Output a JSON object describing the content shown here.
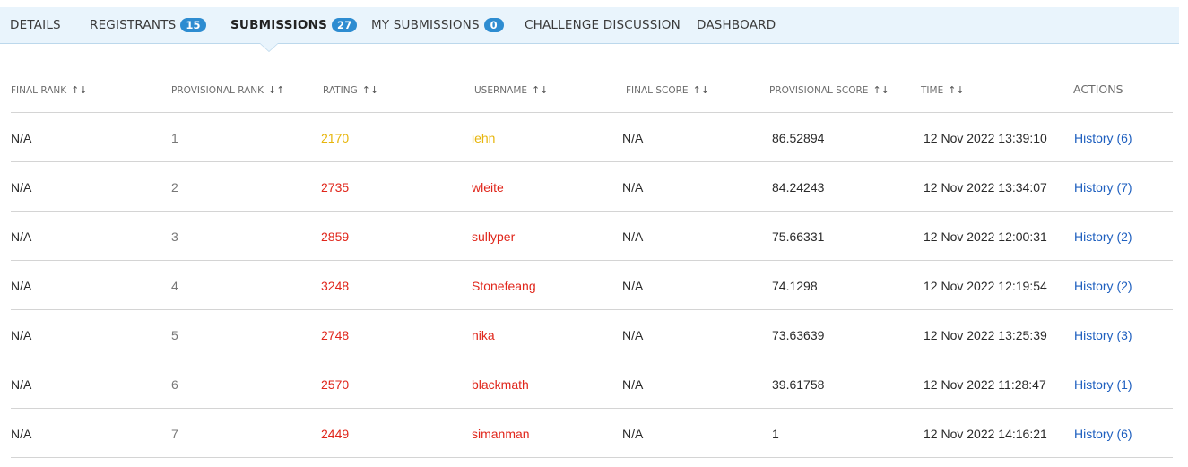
{
  "tabs": [
    {
      "label": "DETAILS",
      "badge": ""
    },
    {
      "label": "REGISTRANTS",
      "badge": "15"
    },
    {
      "label": "SUBMISSIONS",
      "badge": "27"
    },
    {
      "label": "MY SUBMISSIONS",
      "badge": "0"
    },
    {
      "label": "CHALLENGE DISCUSSION",
      "badge": ""
    },
    {
      "label": "DASHBOARD",
      "badge": ""
    }
  ],
  "colors": {
    "rating_yellow": "#e7b50b",
    "rating_red": "#e0261b",
    "link": "#1e5fbf",
    "badge": "#2d8cd1"
  },
  "headers": {
    "final_rank": "FINAL RANK",
    "provisional_rank": "PROVISIONAL RANK",
    "rating": "RATING",
    "username": "USERNAME",
    "final_score": "FINAL SCORE",
    "provisional_score": "PROVISIONAL SCORE",
    "time": "TIME",
    "actions": "ACTIONS",
    "sort_icon": "↑↓",
    "sort_icon_active": "↓↑"
  },
  "rows": [
    {
      "final_rank": "N/A",
      "provisional_rank": "1",
      "rating": "2170",
      "rating_color": "yellow",
      "username": "iehn",
      "final_score": "N/A",
      "provisional_score": "86.52894",
      "time": "12 Nov 2022 13:39:10",
      "action": "History (6)"
    },
    {
      "final_rank": "N/A",
      "provisional_rank": "2",
      "rating": "2735",
      "rating_color": "red",
      "username": "wleite",
      "final_score": "N/A",
      "provisional_score": "84.24243",
      "time": "12 Nov 2022 13:34:07",
      "action": "History (7)"
    },
    {
      "final_rank": "N/A",
      "provisional_rank": "3",
      "rating": "2859",
      "rating_color": "red",
      "username": "sullyper",
      "final_score": "N/A",
      "provisional_score": "75.66331",
      "time": "12 Nov 2022 12:00:31",
      "action": "History (2)"
    },
    {
      "final_rank": "N/A",
      "provisional_rank": "4",
      "rating": "3248",
      "rating_color": "red",
      "username": "Stonefeang",
      "final_score": "N/A",
      "provisional_score": "74.1298",
      "time": "12 Nov 2022 12:19:54",
      "action": "History (2)"
    },
    {
      "final_rank": "N/A",
      "provisional_rank": "5",
      "rating": "2748",
      "rating_color": "red",
      "username": "nika",
      "final_score": "N/A",
      "provisional_score": "73.63639",
      "time": "12 Nov 2022 13:25:39",
      "action": "History (3)"
    },
    {
      "final_rank": "N/A",
      "provisional_rank": "6",
      "rating": "2570",
      "rating_color": "red",
      "username": "blackmath",
      "final_score": "N/A",
      "provisional_score": "39.61758",
      "time": "12 Nov 2022 11:28:47",
      "action": "History (1)"
    },
    {
      "final_rank": "N/A",
      "provisional_rank": "7",
      "rating": "2449",
      "rating_color": "red",
      "username": "simanman",
      "final_score": "N/A",
      "provisional_score": "1",
      "time": "12 Nov 2022 14:16:21",
      "action": "History (6)"
    }
  ]
}
